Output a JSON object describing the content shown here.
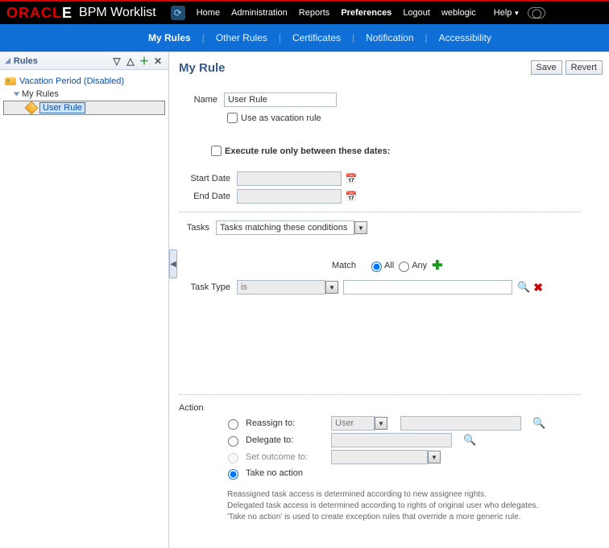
{
  "header": {
    "logo_left": "ORACL",
    "logo_e": "E",
    "app_title": "BPM Worklist",
    "nav": [
      "Home",
      "Administration",
      "Reports",
      "Preferences",
      "Logout",
      "weblogic"
    ],
    "help": "Help"
  },
  "tabs": [
    "My Rules",
    "Other Rules",
    "Certificates",
    "Notification",
    "Accessibility"
  ],
  "sidebar": {
    "title": "Rules",
    "items": [
      {
        "label": "Vacation Period (Disabled)"
      },
      {
        "label": "My Rules"
      },
      {
        "label": "User Rule"
      }
    ]
  },
  "page": {
    "title": "My Rule",
    "save": "Save",
    "revert": "Revert",
    "name_label": "Name",
    "name_value": "User Rule",
    "vac_checkbox": "Use as vacation rule",
    "exec_checkbox": "Execute rule only between these dates:",
    "start_label": "Start Date",
    "end_label": "End Date",
    "tasks_label": "Tasks",
    "tasks_select": "Tasks matching these conditions",
    "match_label": "Match",
    "match_all": "All",
    "match_any": "Any",
    "tasktype_label": "Task Type",
    "tasktype_op": "is",
    "action_label": "Action",
    "actions": {
      "reassign": "Reassign to:",
      "delegate": "Delegate to:",
      "outcome": "Set outcome to:",
      "none": "Take no action",
      "user_sel": "User"
    },
    "help1": "Reassigned task access is determined according to new assignee rights.",
    "help2": "Delegated task access is determined according to rights of original user who delegates.",
    "help3": "'Take no action' is used to create exception rules that override a more generic rule."
  }
}
